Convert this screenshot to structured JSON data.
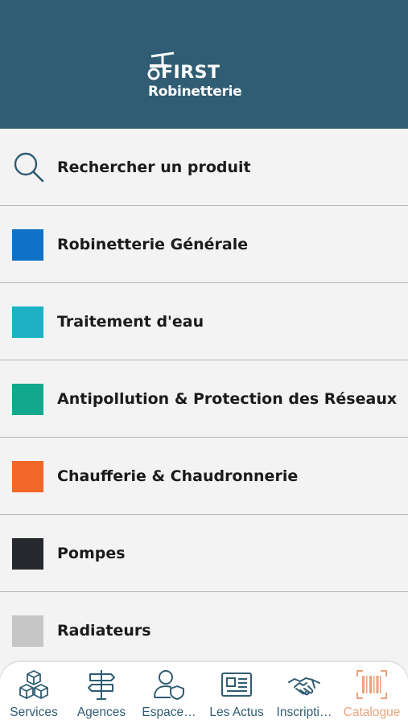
{
  "header": {
    "brand_line1": "FIRST",
    "brand_line2": "Robinetterie",
    "background": "#305d73"
  },
  "menu": {
    "items": [
      {
        "label": "Rechercher un produit",
        "icon": "search-icon"
      },
      {
        "label": "Robinetterie Générale",
        "color": "#1072c6"
      },
      {
        "label": "Traitement d'eau",
        "color": "#1bb0c4"
      },
      {
        "label": "Antipollution & Protection des Réseaux",
        "color": "#10a98e"
      },
      {
        "label": "Chaufferie & Chaudronnerie",
        "color": "#f3662a"
      },
      {
        "label": "Pompes",
        "color": "#262a2e"
      },
      {
        "label": "Radiateurs",
        "color": "#c6c6c6"
      }
    ]
  },
  "tabbar": {
    "tabs": [
      {
        "label": "Services",
        "icon": "cubes-icon"
      },
      {
        "label": "Agences",
        "icon": "signpost-icon"
      },
      {
        "label": "Espace…",
        "icon": "user-shield-icon"
      },
      {
        "label": "Les Actus",
        "icon": "newspaper-icon"
      },
      {
        "label": "Inscripti…",
        "icon": "handshake-icon"
      },
      {
        "label": "Catalogue",
        "icon": "barcode-icon",
        "active": true
      }
    ],
    "color": "#2f5c73",
    "active_color": "#e9a37b"
  }
}
